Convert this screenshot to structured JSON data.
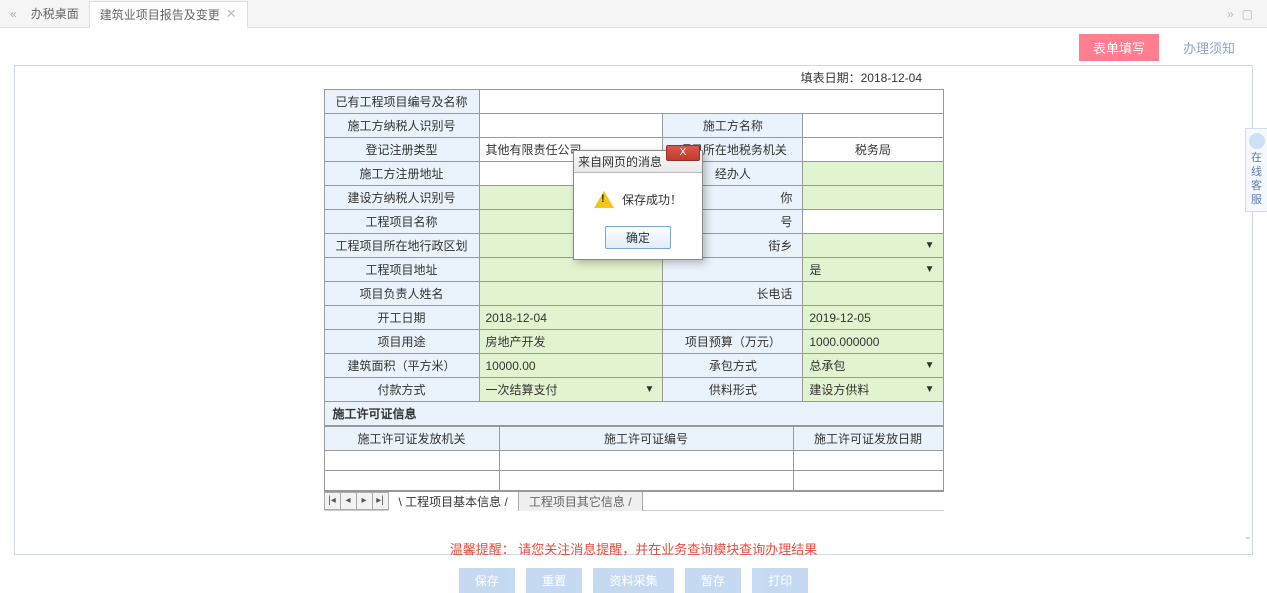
{
  "tabs": {
    "tax_desktop": "办税桌面",
    "building": "建筑业项目报告及变更"
  },
  "subtabs": {
    "fill": "表单填写",
    "notice": "办理须知"
  },
  "fill_date": {
    "label": "填表日期：",
    "value": "2018-12-04"
  },
  "form": {
    "existing_project_label": "已有工程项目编号及名称",
    "contractor_tax_id_label": "施工方纳税人识别号",
    "contractor_name_label": "施工方名称",
    "reg_type_label": "登记注册类型",
    "reg_type_value": "其他有限责任公司",
    "tax_authority_label": "项目所在地税务机关",
    "tax_authority_value": "税务局",
    "contractor_addr_label": "施工方注册地址",
    "agent_label": "经办人",
    "builder_tax_id_label": "建设方纳税人识别号",
    "builder_suffix": "你",
    "project_name_label": "工程项目名称",
    "proj_no_suffix": "号",
    "admin_div_label": "工程项目所在地行政区划",
    "township_suffix": "街乡",
    "project_addr_label": "工程项目地址",
    "yes_value": "是",
    "manager_label": "项目负责人姓名",
    "phone_suffix": "长电话",
    "start_date_label": "开工日期",
    "start_date_value": "2018-12-04",
    "end_date_value": "2019-12-05",
    "usage_label": "项目用途",
    "usage_value": "房地产开发",
    "budget_label": "项目预算（万元）",
    "budget_value": "1000.000000",
    "area_label": "建筑面积（平方米）",
    "area_value": "10000.00",
    "contract_mode_label": "承包方式",
    "contract_mode_value": "总承包",
    "pay_mode_label": "付款方式",
    "pay_mode_value": "一次结算支付",
    "supply_mode_label": "供料形式",
    "supply_mode_value": "建设方供料"
  },
  "permit": {
    "section": "施工许可证信息",
    "col_authority": "施工许可证发放机关",
    "col_number": "施工许可证编号",
    "col_date": "施工许可证发放日期"
  },
  "sheets": {
    "basic": "工程项目基本信息",
    "other": "工程项目其它信息"
  },
  "reminder": "温馨提醒：  请您关注消息提醒，并在业务查询模块查询办理结果",
  "buttons": {
    "save": "保存",
    "reset": "重置",
    "refresh": "资料采集",
    "b4": "暂存",
    "b5": "打印"
  },
  "side": "在线客服",
  "dialog": {
    "title": "来自网页的消息",
    "msg": "保存成功！",
    "ok": "确定",
    "close": "X"
  }
}
